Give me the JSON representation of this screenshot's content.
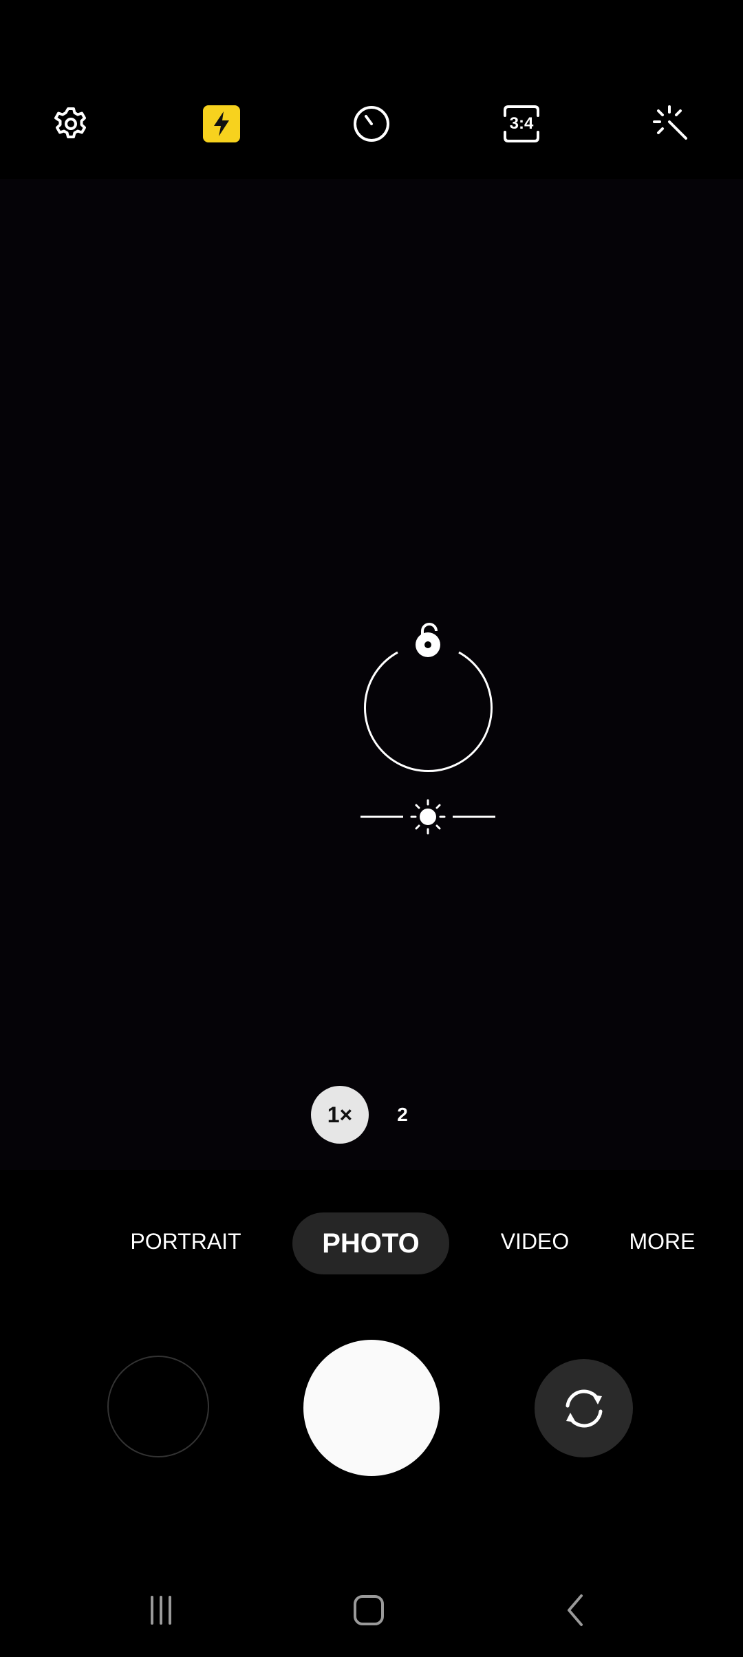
{
  "toolbar": {
    "settings_icon": "gear-icon",
    "flash_icon": "flash-icon",
    "flash_color": "#f7d21e",
    "timer_icon": "timer-icon",
    "ratio_label": "3:4",
    "filter_icon": "magic-wand-icon"
  },
  "viewfinder": {
    "focus_icon": "focus-lock-icon",
    "exposure_icon": "sun-icon"
  },
  "zoom": {
    "selected_label": "1×",
    "option_label": "2"
  },
  "modes": {
    "items": [
      "PORTRAIT",
      "PHOTO",
      "VIDEO",
      "MORE"
    ],
    "active": "PHOTO"
  },
  "controls": {
    "gallery_icon": "gallery-thumbnail",
    "shutter_icon": "shutter-button",
    "switch_icon": "switch-camera-icon"
  },
  "navbar": {
    "recents_icon": "recents-icon",
    "home_icon": "home-icon",
    "back_icon": "back-icon"
  }
}
